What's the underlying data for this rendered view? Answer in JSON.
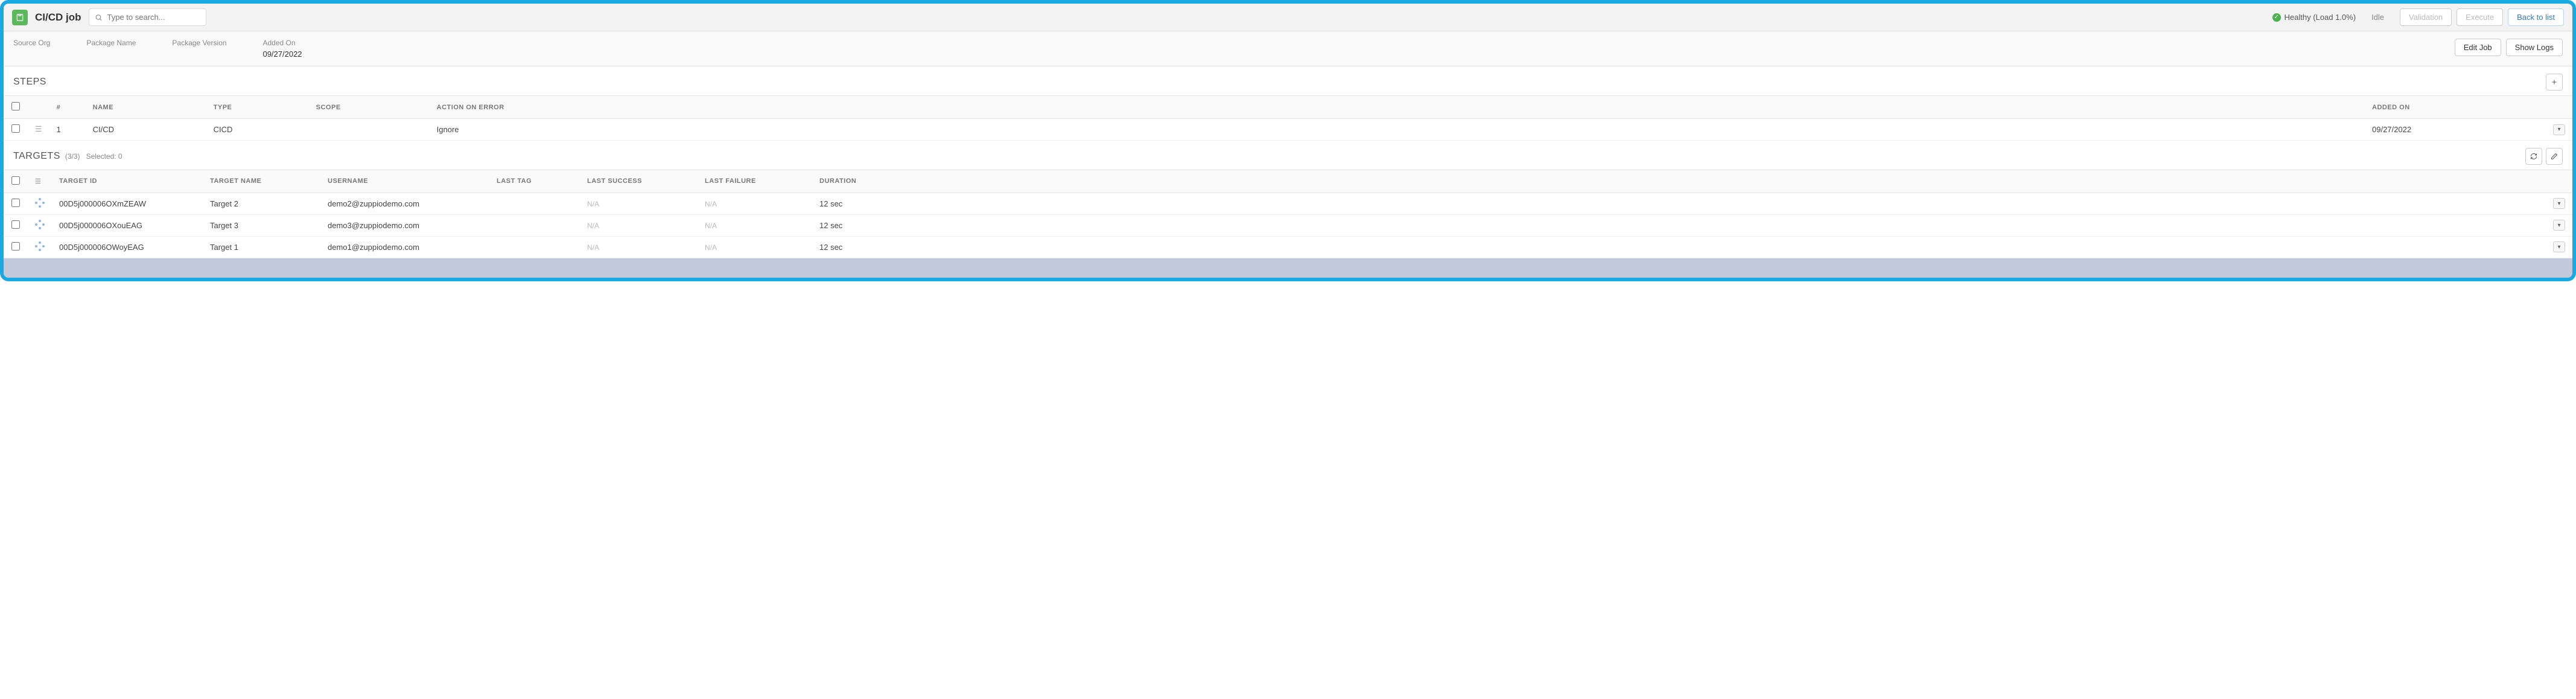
{
  "header": {
    "title": "CI/CD job",
    "search_placeholder": "Type to search...",
    "health": "Healthy (Load 1.0%)",
    "idle": "Idle",
    "buttons": {
      "validation": "Validation",
      "execute": "Execute",
      "back": "Back to list"
    }
  },
  "meta": {
    "source_org": {
      "label": "Source Org",
      "value": ""
    },
    "package_name": {
      "label": "Package Name",
      "value": ""
    },
    "package_version": {
      "label": "Package Version",
      "value": ""
    },
    "added_on": {
      "label": "Added On",
      "value": "09/27/2022"
    },
    "edit_job": "Edit Job",
    "show_logs": "Show Logs"
  },
  "steps": {
    "title": "STEPS",
    "columns": {
      "num": "#",
      "name": "NAME",
      "type": "TYPE",
      "scope": "SCOPE",
      "action": "ACTION ON ERROR",
      "added": "ADDED ON"
    },
    "rows": [
      {
        "num": "1",
        "name": "CI/CD",
        "type": "CICD",
        "scope": "",
        "action": "Ignore",
        "added": "09/27/2022"
      }
    ]
  },
  "targets": {
    "title": "TARGETS",
    "count": "(3/3)",
    "selected": "Selected: 0",
    "columns": {
      "id": "TARGET ID",
      "name": "TARGET NAME",
      "user": "USERNAME",
      "tag": "LAST TAG",
      "success": "LAST SUCCESS",
      "failure": "LAST FAILURE",
      "duration": "DURATION"
    },
    "rows": [
      {
        "id": "00D5j000006OXmZEAW",
        "name": "Target 2",
        "user": "demo2@zuppiodemo.com",
        "tag": "",
        "success": "N/A",
        "failure": "N/A",
        "duration": "12 sec"
      },
      {
        "id": "00D5j000006OXouEAG",
        "name": "Target 3",
        "user": "demo3@zuppiodemo.com",
        "tag": "",
        "success": "N/A",
        "failure": "N/A",
        "duration": "12 sec"
      },
      {
        "id": "00D5j000006OWoyEAG",
        "name": "Target 1",
        "user": "demo1@zuppiodemo.com",
        "tag": "",
        "success": "N/A",
        "failure": "N/A",
        "duration": "12 sec"
      }
    ]
  }
}
